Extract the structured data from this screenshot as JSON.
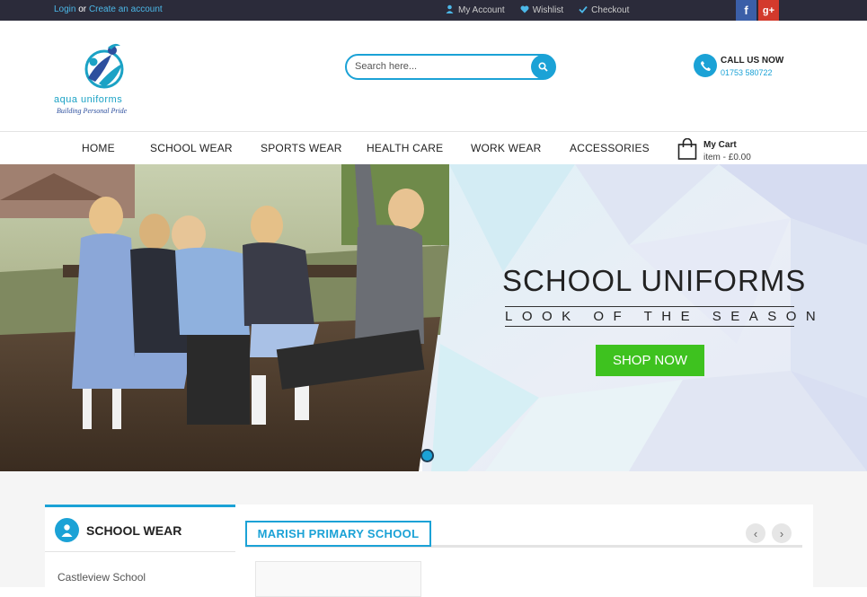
{
  "topbar": {
    "login": "Login",
    "or": "or",
    "create_account": "Create an account",
    "links": [
      {
        "label": "My Account",
        "icon": "user-icon"
      },
      {
        "label": "Wishlist",
        "icon": "heart-icon"
      },
      {
        "label": "Checkout",
        "icon": "check-icon"
      }
    ],
    "social": [
      {
        "glyph": "f",
        "icon": "facebook-icon",
        "color": "#3b5fa8"
      },
      {
        "glyph": "g+",
        "icon": "google-plus-icon",
        "color": "#d33a2c"
      }
    ]
  },
  "header": {
    "brand": "aqua uniforms",
    "tagline": "Building Personal Pride",
    "search_placeholder": "Search here...",
    "call_label": "CALL US NOW",
    "phone": "01753 580722"
  },
  "nav": {
    "items": [
      "HOME",
      "SCHOOL WEAR",
      "SPORTS WEAR",
      "HEALTH CARE",
      "WORK WEAR",
      "ACCESSORIES"
    ],
    "cart_label": "My Cart",
    "cart_summary": "item - £0.00"
  },
  "hero": {
    "title": "SCHOOL UNIFORMS",
    "subtitle": "LOOK OF THE SEASON",
    "cta": "SHOP NOW"
  },
  "sidebar": {
    "title": "SCHOOL WEAR",
    "items": [
      "Castleview School"
    ]
  },
  "main": {
    "tab": "MARISH PRIMARY SCHOOL",
    "prev": "‹",
    "next": "›"
  },
  "colors": {
    "accent": "#1ba2d6",
    "topbar": "#2b2b3a",
    "cta": "#3ec21f"
  }
}
